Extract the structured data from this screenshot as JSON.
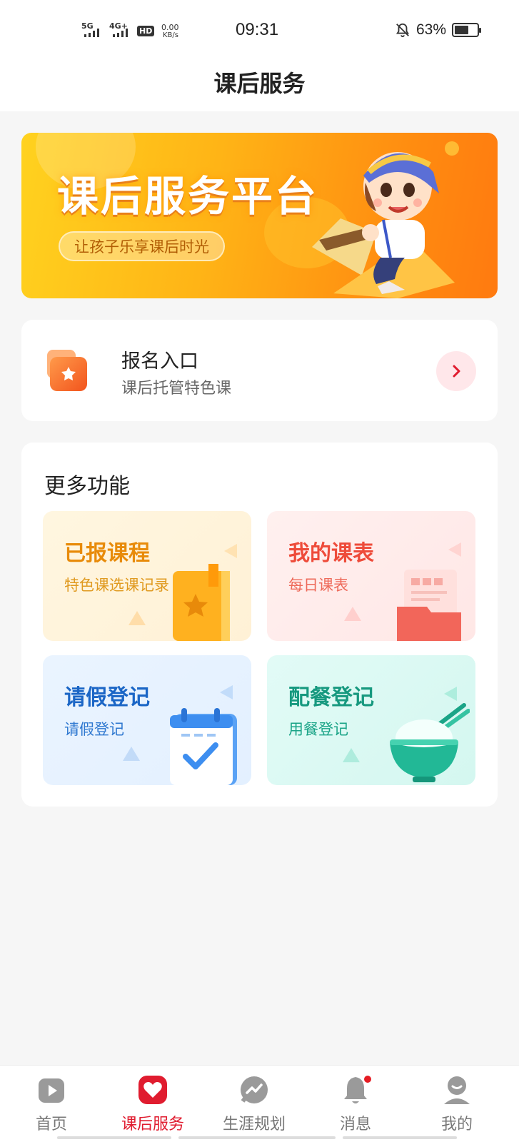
{
  "status_bar": {
    "signal1": "5G",
    "signal2": "4G+",
    "hd": "HD",
    "net_speed": "0.00",
    "net_unit": "KB/s",
    "time": "09:31",
    "battery_text": "63%",
    "battery_level": 0.63
  },
  "header": {
    "title": "课后服务"
  },
  "banner": {
    "title": "课后服务平台",
    "subtitle": "让孩子乐享课后时光"
  },
  "signup": {
    "title": "报名入口",
    "subtitle": "课后托管特色课"
  },
  "more": {
    "title": "更多功能",
    "tiles": [
      {
        "title": "已报课程",
        "subtitle": "特色课选课记录"
      },
      {
        "title": "我的课表",
        "subtitle": "每日课表"
      },
      {
        "title": "请假登记",
        "subtitle": "请假登记"
      },
      {
        "title": "配餐登记",
        "subtitle": "用餐登记"
      }
    ]
  },
  "tabbar": {
    "items": [
      {
        "label": "首页",
        "icon": "play-icon"
      },
      {
        "label": "课后服务",
        "icon": "heart-icon",
        "active": true
      },
      {
        "label": "生涯规划",
        "icon": "trend-chat-icon"
      },
      {
        "label": "消息",
        "icon": "bell-icon",
        "badge": true
      },
      {
        "label": "我的",
        "icon": "person-icon"
      }
    ]
  },
  "colors": {
    "accent": "#e01c2f",
    "banner": "#ffb416"
  }
}
